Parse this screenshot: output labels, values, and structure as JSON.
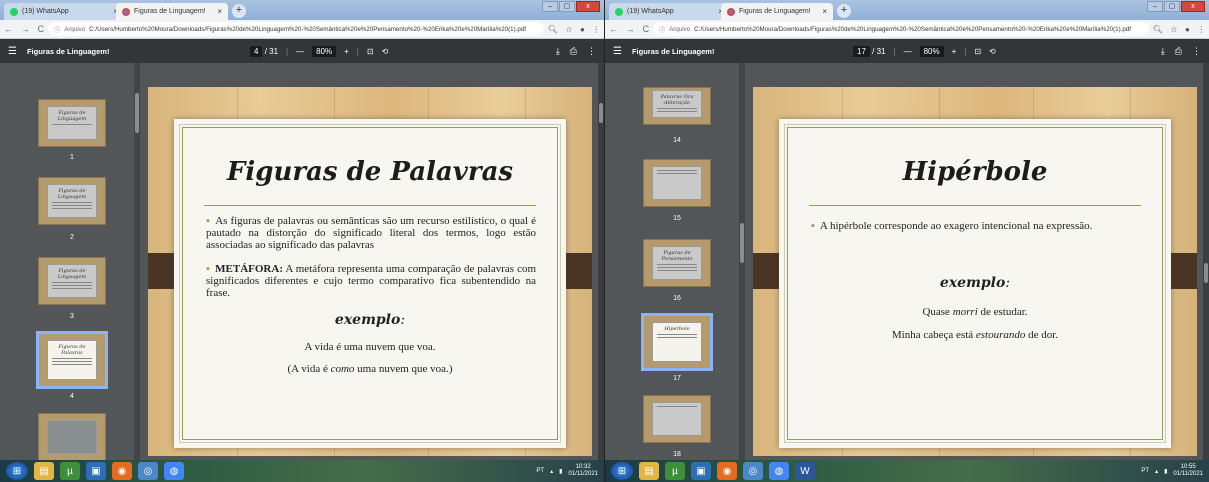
{
  "left": {
    "tabs": {
      "whatsapp": "(19) WhatsApp",
      "pdf": "Figuras de Linguagem!",
      "close": "×",
      "new_tab": "+"
    },
    "window_buttons": {
      "minimize": "–",
      "restore": "▢",
      "close": "x"
    },
    "address": {
      "archive_label": "Arquivo",
      "url": "C:/Users/Humberto%20Moura/Downloads/Figuras%20de%20Linguagem%20-%20Semântica%20e%20Pensamento%20-%20Erika%20e%20Marília%20(1).pdf"
    },
    "pdf_toolbar": {
      "title": "Figuras de Linguagem!",
      "page_current": "4",
      "page_total": "/ 31",
      "zoom_minus": "—",
      "zoom": "80%",
      "zoom_plus": "+"
    },
    "thumbnails": [
      {
        "label": "1",
        "title": "Figuras de Linguagem"
      },
      {
        "label": "2",
        "title": "Figuras de Linguagem"
      },
      {
        "label": "3",
        "title": "Figuras de Linguagem"
      },
      {
        "label": "4",
        "title": "Figuras de Palavras"
      },
      {
        "label": "",
        "title": ""
      }
    ],
    "slide": {
      "title": "Figuras de Palavras",
      "bullet1": "As figuras de palavras ou semânticas são um recurso estilístico, o qual é pautado na distorção do significado literal dos termos, logo estão associadas ao significado das palavras",
      "bullet2_bold": "METÁFORA:",
      "bullet2_rest": " A metáfora representa uma comparação de palavras com significados diferentes e cujo termo comparativo fica subentendido na frase.",
      "example_title": "exemplo",
      "example_colon": ":",
      "ex1": "A vida é uma nuvem que voa.",
      "ex2_a": "(A vida é ",
      "ex2_em": "como",
      "ex2_b": " uma nuvem que voa.)"
    },
    "taskbar": {
      "lang": "PT",
      "time": "10:32",
      "date": "01/11/2021"
    }
  },
  "right": {
    "tabs": {
      "whatsapp": "(19) WhatsApp",
      "pdf": "Figuras de Linguagem!",
      "close": "×",
      "new_tab": "+"
    },
    "window_buttons": {
      "minimize": "–",
      "restore": "▢",
      "close": "x"
    },
    "address": {
      "archive_label": "Arquivo",
      "url": "C:/Users/Humberto%20Moura/Downloads/Figuras%20de%20Linguagem%20-%20Semântica%20e%20Pensamento%20-%20Erika%20e%20Marília%20(1).pdf"
    },
    "pdf_toolbar": {
      "title": "Figuras de Linguagem!",
      "page_current": "17",
      "page_total": "/ 31",
      "zoom_minus": "—",
      "zoom": "80%",
      "zoom_plus": "+"
    },
    "thumbnails": [
      {
        "label": "14",
        "title": "Palavras Oca Aliteração"
      },
      {
        "label": "15",
        "title": ""
      },
      {
        "label": "16",
        "title": "Figuras de Pensamento"
      },
      {
        "label": "17",
        "title": "Hipérbole"
      },
      {
        "label": "18",
        "title": ""
      }
    ],
    "slide": {
      "title": "Hipérbole",
      "bullet1": "A hipérbole corresponde ao exagero intencional na expressão.",
      "example_title": "exemplo",
      "example_colon": ":",
      "ex1_a": "Quase ",
      "ex1_em": "morri",
      "ex1_b": " de estudar.",
      "ex2_a": "Minha cabeça está ",
      "ex2_em": "estourando",
      "ex2_b": " de dor."
    },
    "taskbar": {
      "lang": "PT",
      "time": "10:55",
      "date": "01/11/2021"
    }
  },
  "icons": {
    "whatsapp_color": "#25d366",
    "chrome_color": "#4285f4",
    "accent_olive": "#8fa05a",
    "pdf_toolbar_bg": "#323639"
  }
}
